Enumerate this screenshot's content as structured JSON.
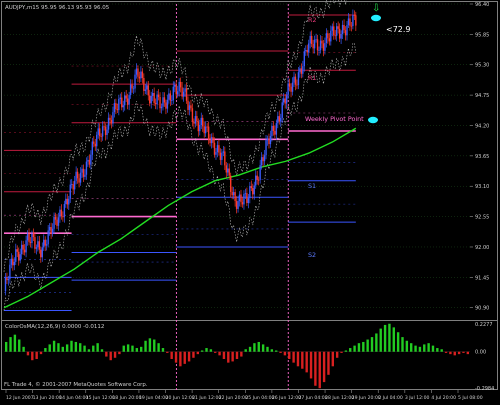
{
  "header": {
    "main_title": "AUDJPY,m15  95.95 96.13 95.93 96.05",
    "osc_title": "ColorOsMA(12,26,9)  0.0000  -0.0112",
    "copyright": "FL Trade 4, © 2001-2007 MetaQuotes Software Corp."
  },
  "labels": {
    "current_marker": "<72.9",
    "weekly_pivot": "Weekly Pivot Point",
    "r2": "R2",
    "r1": "R1",
    "s1": "S1",
    "s2": "S2",
    "arrow_glyph": "⇩"
  },
  "colors": {
    "background": "#000000",
    "bull_candle": "#3a5cff",
    "bear_candle": "#ff3a2a",
    "pivot_line": "#e43a78",
    "pivot_bold": "#ff6ad0",
    "ma_line": "#22dd22",
    "band_line": "#bfbfbf",
    "resistance": "#c01b3e",
    "support": "#3b55ff",
    "osc_up": "#22cc22",
    "osc_down": "#d82020",
    "marker": "#22eeff"
  },
  "chart_data": [
    {
      "type": "line",
      "title": "AUDJPY,m15  95.95 96.13 95.93 96.05",
      "ylim": [
        90.75,
        96.4
      ],
      "y_ticks": [
        96.4,
        95.85,
        95.3,
        94.75,
        94.2,
        93.65,
        93.1,
        92.55,
        92.0,
        91.45,
        90.9
      ],
      "y_tick_labels": [
        "96.40",
        "95.85",
        "95.30",
        "94.75",
        "94.20",
        "93.65",
        "93.10",
        "92.55",
        "92.00",
        "91.45",
        "90.90"
      ],
      "x_tick_labels": [
        "12 Jun 2007",
        "13 Jun 20:00",
        "14 Jun 04:00",
        "15 Jun 12:00",
        "18 Jun 20:00",
        "19 Jun 04:00",
        "20 Jun 12:00",
        "21 Jun 12:00",
        "22 Jun 20:00",
        "25 Jun 04:00",
        "26 Jun 12:00",
        "27 Jun 04:00",
        "28 Jun 12:00",
        "29 Jun 20:00",
        "2 Jul 04:00",
        "3 Jul 12:00",
        "4 Jul 20:00",
        "5 Jul 08:00"
      ],
      "price_path": [
        91.2,
        91.9,
        92.1,
        92.0,
        92.3,
        92.8,
        93.2,
        93.6,
        94.1,
        94.4,
        94.7,
        95.1,
        94.8,
        94.5,
        94.9,
        94.7,
        94.2,
        94.0,
        93.6,
        92.9,
        92.8,
        93.4,
        94.0,
        94.6,
        95.0,
        95.6,
        95.7,
        95.8,
        96.0,
        96.05
      ],
      "series": [
        {
          "name": "Weekly Pivot Point",
          "segments": [
            {
              "from": 0,
              "to": 0.145,
              "value": 92.25
            },
            {
              "from": 0.145,
              "to": 0.37,
              "value": 92.55
            },
            {
              "from": 0.37,
              "to": 0.61,
              "value": 93.95
            },
            {
              "from": 0.61,
              "to": 0.755,
              "value": 94.1
            }
          ]
        },
        {
          "segments": [
            {
              "from": 0,
              "to": 0.145,
              "value": 93.75
            },
            {
              "from": 0.145,
              "to": 0.37,
              "value": 94.95
            },
            {
              "from": 0.37,
              "to": 0.61,
              "value": 95.55
            },
            {
              "from": 0.61,
              "to": 0.755,
              "value": 96.2
            }
          ]
        },
        {
          "segments": [
            {
              "from": 0,
              "to": 0.145,
              "value": 93.0
            },
            {
              "from": 0.145,
              "to": 0.37,
              "value": 94.25
            },
            {
              "from": 0.37,
              "to": 0.61,
              "value": 94.75
            },
            {
              "from": 0.61,
              "to": 0.755,
              "value": 95.2
            }
          ]
        },
        {
          "segments": [
            {
              "from": 0,
              "to": 0.145,
              "value": 91.45
            },
            {
              "from": 0.145,
              "to": 0.37,
              "value": 91.9
            },
            {
              "from": 0.37,
              "to": 0.61,
              "value": 92.9
            },
            {
              "from": 0.61,
              "to": 0.755,
              "value": 93.2
            }
          ]
        },
        {
          "segments": [
            {
              "from": 0,
              "to": 0.145,
              "value": 90.85
            },
            {
              "from": 0.145,
              "to": 0.37,
              "value": 91.4
            },
            {
              "from": 0.37,
              "to": 0.61,
              "value": 92.0
            },
            {
              "from": 0.61,
              "to": 0.755,
              "value": 92.45
            }
          ]
        },
        {
          "values": [
            90.9,
            91.1,
            91.35,
            91.6,
            91.9,
            92.15,
            92.45,
            92.75,
            93.0,
            93.2,
            93.3,
            93.45,
            93.55,
            93.7,
            93.9,
            94.15
          ]
        }
      ]
    },
    {
      "type": "bar",
      "title": "ColorOsMA(12,26,9)  0.0000  -0.0112",
      "y_tick_labels": [
        "0.2277",
        "0.00",
        "-0.2984"
      ],
      "ylim": [
        -0.2984,
        0.2277
      ],
      "values": [
        0.08,
        0.12,
        0.14,
        0.1,
        0.04,
        -0.03,
        -0.07,
        -0.06,
        -0.02,
        0.03,
        0.06,
        0.09,
        0.07,
        0.04,
        0.06,
        0.09,
        0.08,
        0.07,
        0.05,
        0.02,
        0.05,
        0.07,
        0.02,
        -0.04,
        -0.07,
        -0.05,
        -0.02,
        0.05,
        0.06,
        0.05,
        0.03,
        0.04,
        0.09,
        0.11,
        0.1,
        0.07,
        0.03,
        -0.01,
        -0.06,
        -0.09,
        -0.12,
        -0.1,
        -0.08,
        -0.05,
        -0.02,
        0.01,
        0.03,
        0.02,
        -0.01,
        -0.03,
        -0.06,
        -0.09,
        -0.08,
        -0.06,
        -0.04,
        0.02,
        0.04,
        0.07,
        0.08,
        0.06,
        0.04,
        0.02,
        0.01,
        -0.01,
        -0.03,
        -0.06,
        -0.09,
        -0.12,
        -0.14,
        -0.17,
        -0.22,
        -0.28,
        -0.3,
        -0.25,
        -0.19,
        -0.12,
        -0.05,
        -0.01,
        0.01,
        0.03,
        0.05,
        0.07,
        0.08,
        0.1,
        0.12,
        0.15,
        0.19,
        0.22,
        0.23,
        0.2,
        0.16,
        0.12,
        0.09,
        0.07,
        0.05,
        0.04,
        0.06,
        0.07,
        0.05,
        0.03,
        0.02,
        -0.01,
        -0.02,
        -0.03,
        -0.02,
        -0.01,
        -0.02
      ]
    }
  ]
}
